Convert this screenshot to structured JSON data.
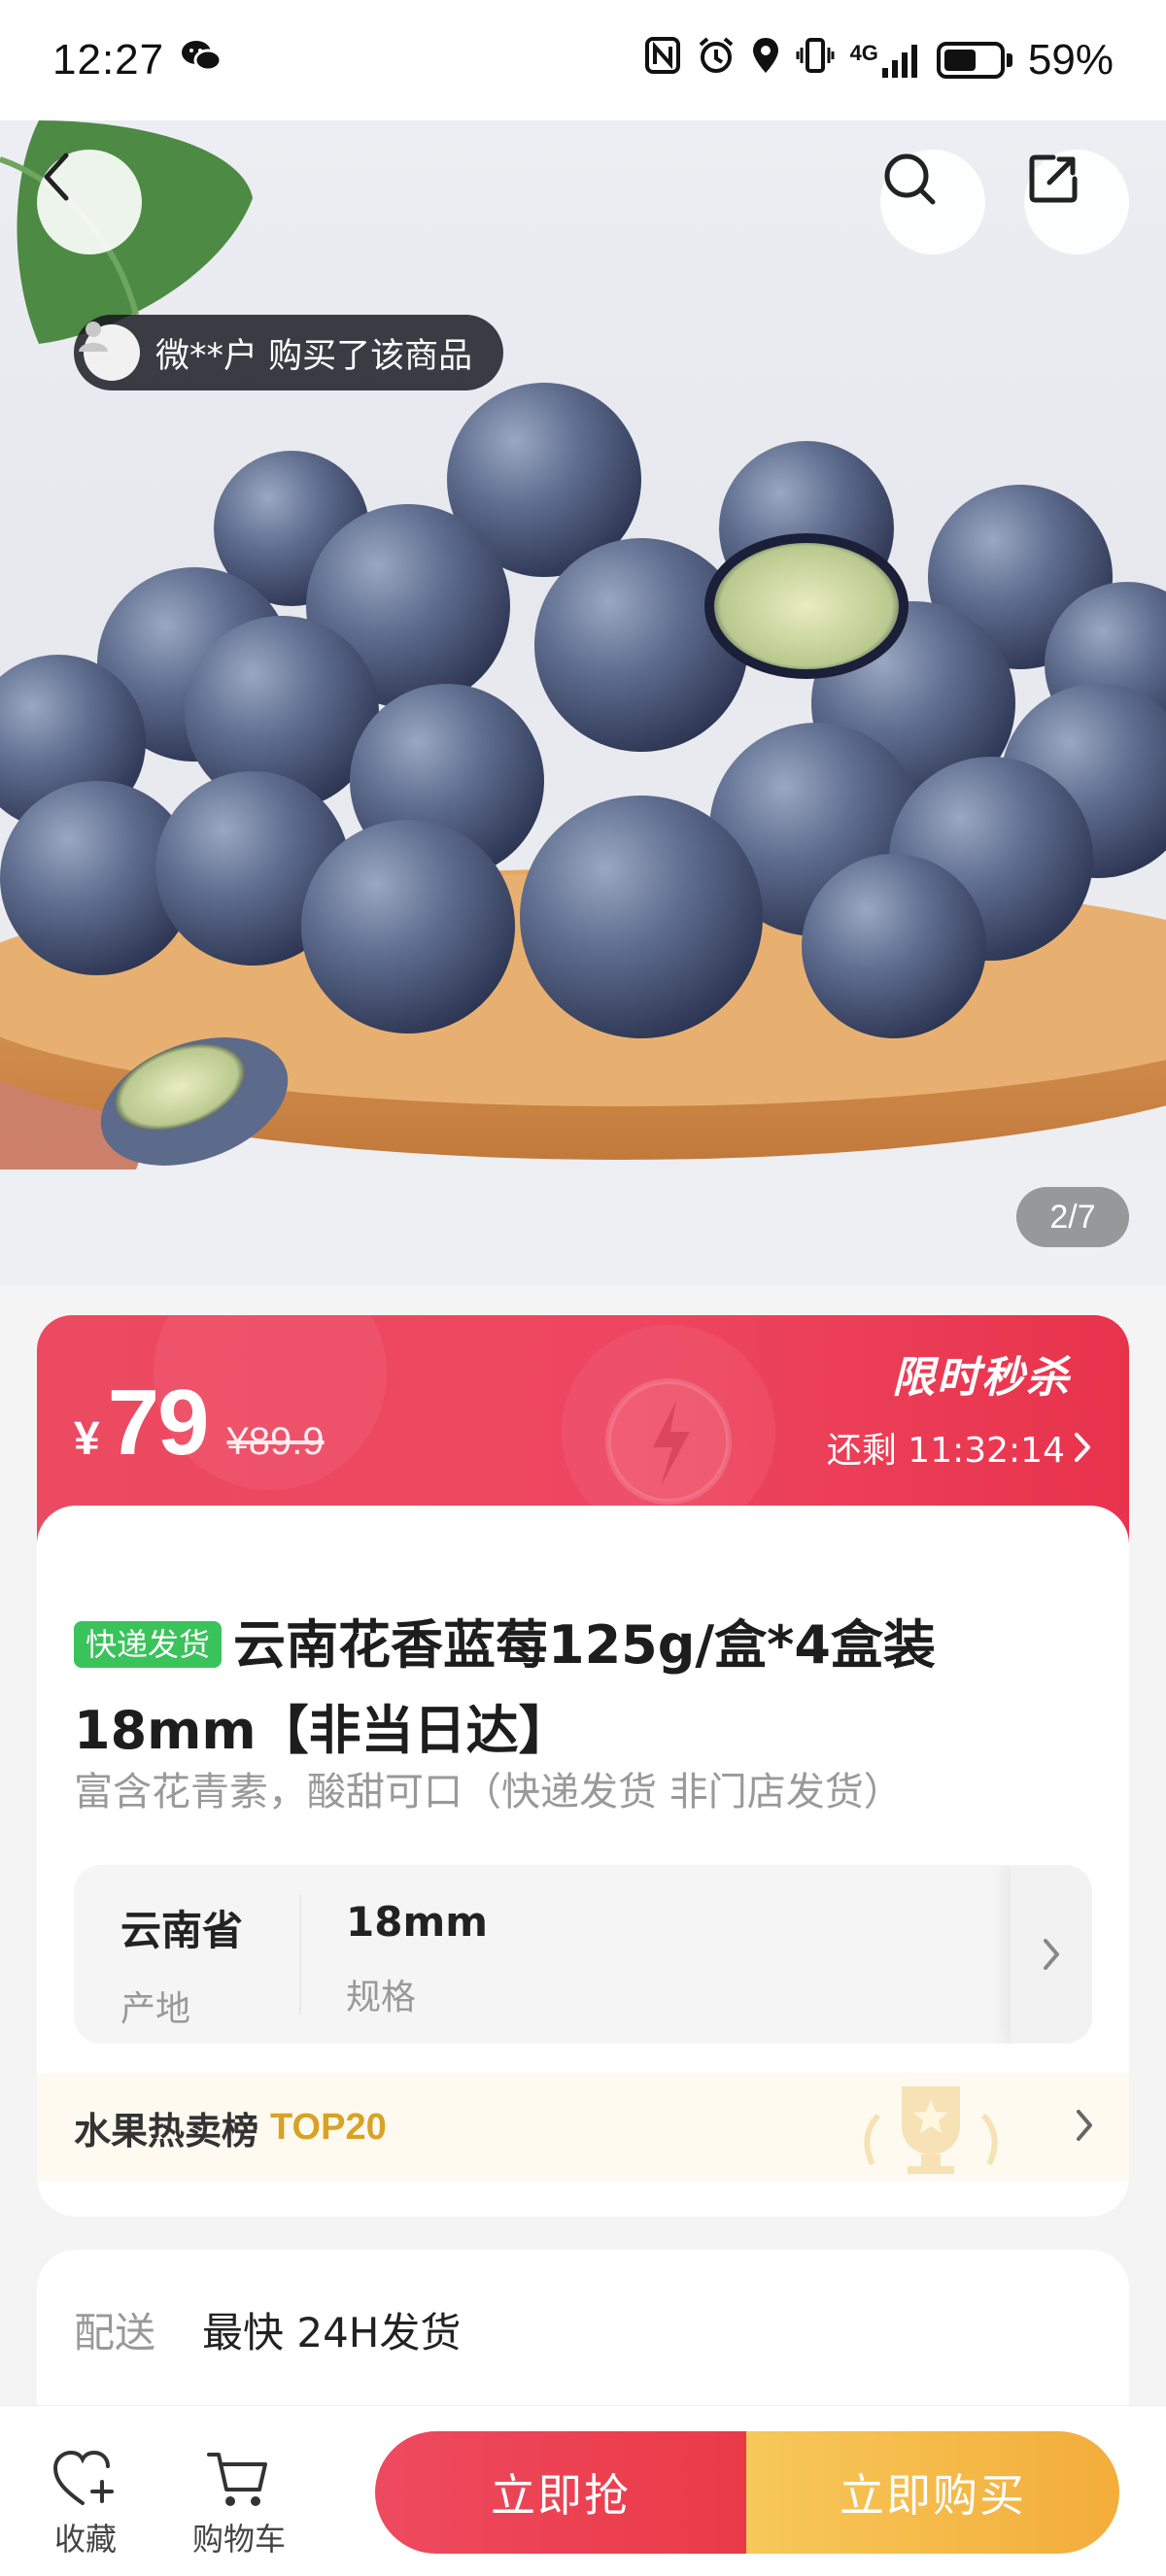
{
  "status_bar": {
    "time": "12:27",
    "network": "4G",
    "battery": "59%",
    "battery_level": 0.59
  },
  "hero": {
    "buyer_notice": "微**户 购买了该商品",
    "image_counter": "2/7",
    "icons": [
      "back-icon",
      "search-icon",
      "share-icon"
    ]
  },
  "price": {
    "currency": "¥",
    "current": "79",
    "original": "¥89.9",
    "flash_sale_label": "限时秒杀",
    "countdown": "还剩 11:32:14"
  },
  "product": {
    "tag": "快递发货",
    "title": "云南花香蓝莓125g/盒*4盒装18mm【非当日达】",
    "subtitle": "富含花青素，酸甜可口（快递发货 非门店发货）",
    "specs": [
      {
        "value": "云南省",
        "label": "产地"
      },
      {
        "value": "18mm",
        "label": "规格"
      }
    ],
    "rank_label": "水果热卖榜",
    "rank_top": "TOP20"
  },
  "delivery": {
    "label": "配送",
    "value": "最快 24H发货"
  },
  "bottom_bar": {
    "favorite": "收藏",
    "cart": "购物车",
    "grab_now": "立即抢",
    "buy_now": "立即购买"
  },
  "colors": {
    "price_red": "#ec4a61",
    "buy_yellow": "#f3ad3a",
    "tag_green": "#39c35a",
    "rank_gold": "#d9a224"
  }
}
